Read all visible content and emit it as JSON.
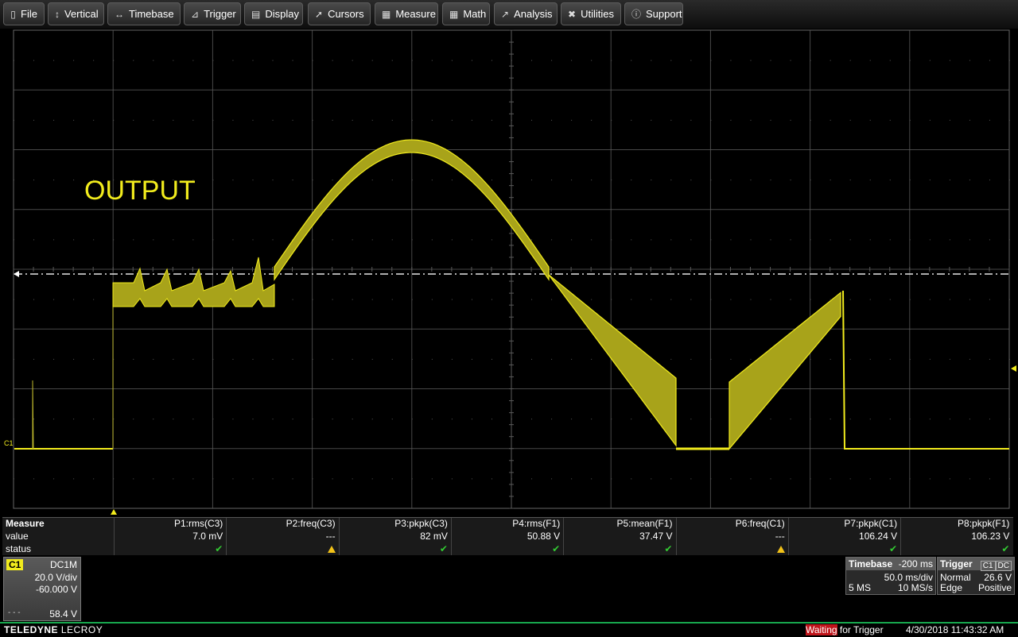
{
  "menu": [
    {
      "label": "File",
      "icon": "file-icon"
    },
    {
      "label": "Vertical",
      "icon": "vertical-arrows-icon"
    },
    {
      "label": "Timebase",
      "icon": "horizontal-arrows-icon"
    },
    {
      "label": "Trigger",
      "icon": "trigger-icon"
    },
    {
      "label": "Display",
      "icon": "display-icon"
    },
    {
      "label": "Cursors",
      "icon": "cursor-icon"
    },
    {
      "label": "Measure",
      "icon": "measure-icon"
    },
    {
      "label": "Math",
      "icon": "calculator-icon"
    },
    {
      "label": "Analysis",
      "icon": "analysis-chart-icon"
    },
    {
      "label": "Utilities",
      "icon": "tools-icon"
    },
    {
      "label": "Support",
      "icon": "info-icon"
    }
  ],
  "display": {
    "annotation": "OUTPUT",
    "channel_marker": "C1",
    "trace_color": "#f2ec1d",
    "grid_divisions": {
      "horizontal": 10,
      "vertical": 8
    }
  },
  "measure": {
    "title": "Measure",
    "row_labels": [
      "value",
      "status"
    ],
    "params": [
      {
        "name": "P1:rms(C3)",
        "value": "7.0 mV",
        "status": "ok"
      },
      {
        "name": "P2:freq(C3)",
        "value": "---",
        "status": "warning"
      },
      {
        "name": "P3:pkpk(C3)",
        "value": "82 mV",
        "status": "ok"
      },
      {
        "name": "P4:rms(F1)",
        "value": "50.88 V",
        "status": "ok"
      },
      {
        "name": "P5:mean(F1)",
        "value": "37.47 V",
        "status": "ok"
      },
      {
        "name": "P6:freq(C1)",
        "value": "---",
        "status": "warning"
      },
      {
        "name": "P7:pkpk(C1)",
        "value": "106.24 V",
        "status": "ok"
      },
      {
        "name": "P8:pkpk(F1)",
        "value": "106.23 V",
        "status": "ok"
      }
    ]
  },
  "channel": {
    "name": "C1",
    "coupling": "DC1M",
    "scale": "20.0 V/div",
    "offset": "-60.000 V",
    "level": "58.4 V"
  },
  "timebase": {
    "title": "Timebase",
    "delay": "-200 ms",
    "scale": "50.0 ms/div",
    "memory": "5 MS",
    "sample_rate": "10 MS/s"
  },
  "trigger": {
    "title": "Trigger",
    "source": "C1",
    "coupling": "DC",
    "mode": "Normal",
    "level": "26.6 V",
    "type": "Edge",
    "slope": "Positive"
  },
  "status": {
    "brand_bold": "TELEDYNE",
    "brand_light": "LECROY",
    "waiting_highlight": "Waiting",
    "waiting_rest": " for Trigger",
    "datetime": "4/30/2018 11:43:32 AM"
  }
}
